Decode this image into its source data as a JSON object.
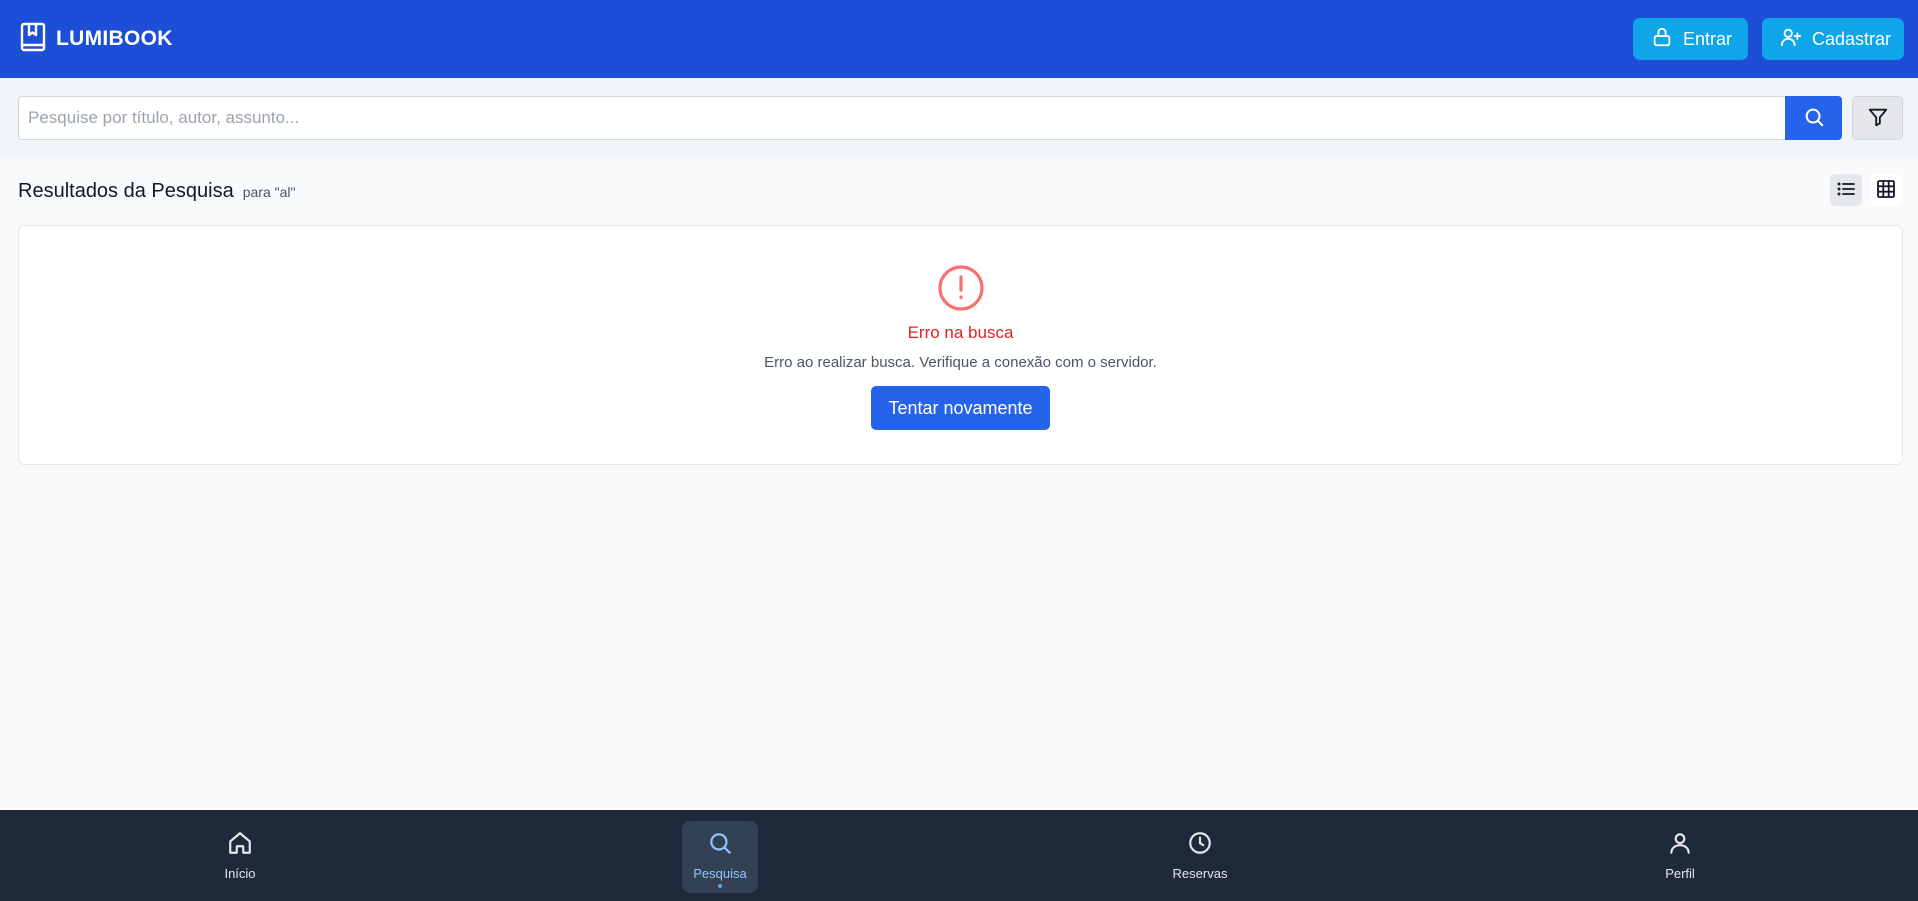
{
  "header": {
    "brand": "LUMIBOOK",
    "login_label": "Entrar",
    "register_label": "Cadastrar"
  },
  "search": {
    "placeholder": "Pesquise por título, autor, assunto...",
    "value": ""
  },
  "results": {
    "title": "Resultados da Pesquisa",
    "subtitle": "para \"al\""
  },
  "error": {
    "title": "Erro na busca",
    "message": "Erro ao realizar busca. Verifique a conexão com o servidor.",
    "retry_label": "Tentar novamente"
  },
  "nav": {
    "items": [
      {
        "label": "Início",
        "icon": "home-icon",
        "active": false
      },
      {
        "label": "Pesquisa",
        "icon": "search-icon",
        "active": true
      },
      {
        "label": "Reservas",
        "icon": "clock-icon",
        "active": false
      },
      {
        "label": "Perfil",
        "icon": "user-icon",
        "active": false
      }
    ]
  },
  "colors": {
    "header_bg": "#1d4ed8",
    "accent_button": "#0ea5e9",
    "primary": "#2563eb",
    "error": "#dc2626",
    "nav_bg": "#1e293b"
  }
}
